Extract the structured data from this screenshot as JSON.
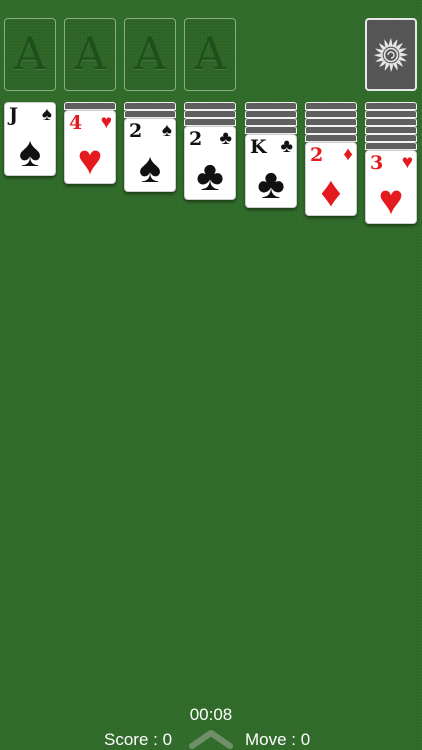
{
  "foundations": [
    {
      "label": "A"
    },
    {
      "label": "A"
    },
    {
      "label": "A"
    },
    {
      "label": "A"
    }
  ],
  "stock": {
    "icon": "sun-swirl-icon"
  },
  "tableau": [
    {
      "facedown": 0,
      "rank": "J",
      "suit": "♠",
      "color": "black"
    },
    {
      "facedown": 1,
      "rank": "4",
      "suit": "♥",
      "color": "red"
    },
    {
      "facedown": 2,
      "rank": "2",
      "suit": "♠",
      "color": "black"
    },
    {
      "facedown": 3,
      "rank": "2",
      "suit": "♣",
      "color": "black"
    },
    {
      "facedown": 4,
      "rank": "K",
      "suit": "♣",
      "color": "black"
    },
    {
      "facedown": 5,
      "rank": "2",
      "suit": "♦",
      "color": "red"
    },
    {
      "facedown": 6,
      "rank": "3",
      "suit": "♥",
      "color": "red"
    }
  ],
  "status": {
    "timer": "00:08",
    "score": "Score : 0",
    "moves": "Move : 0"
  },
  "colors": {
    "felt": "#2f6a28",
    "red_suit": "#e41a1e",
    "black_suit": "#111111"
  }
}
